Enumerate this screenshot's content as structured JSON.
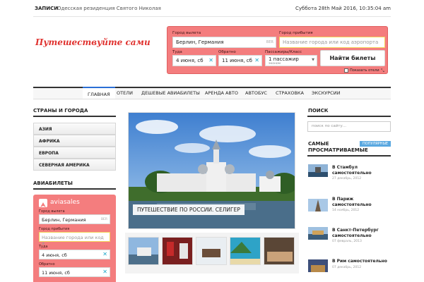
{
  "topbar": {
    "label": "ЗАПИСИ",
    "ticker": "Одесская резиденция Святого Николая",
    "datetime": "Суббота 28th Май 2016, 10:35:04 am"
  },
  "logo": {
    "text": "Путешествуйте сами"
  },
  "search_widget": {
    "from_label": "Город вылета",
    "from_value": "Берлин, Германия",
    "from_iata": "BER",
    "to_label": "Город прибытия",
    "to_placeholder": "Название города или код аэропорта",
    "depart_label": "Туда",
    "depart_value": "4 июня, сб",
    "return_label": "Обратно",
    "return_value": "11 июня, сб",
    "pax_label": "Пассажиры/Класс",
    "pax_value": "1 пассажир",
    "pax_class": "эконом",
    "find_button": "Найти билеты",
    "show_hotels": "Показать отели"
  },
  "nav": {
    "items": [
      "ГЛАВНАЯ",
      "ОТЕЛИ",
      "ДЕШЕВЫЕ АВИАБИЛЕТЫ",
      "АРЕНДА АВТО",
      "АВТОБУС",
      "СТРАХОВКА",
      "ЭКСКУРСИИ"
    ]
  },
  "left": {
    "countries_title": "СТРАНЫ И ГОРОДА",
    "categories": [
      "АЗИЯ",
      "АФРИКА",
      "ЕВРОПА",
      "СЕВЕРНАЯ АМЕРИКА"
    ],
    "avia_title": "АВИАБИЛЕТЫ",
    "avia": {
      "brand": "aviasales",
      "from_label": "Город вылета",
      "from_value": "Берлин, Германия",
      "from_iata": "BER",
      "to_label": "Город прибытия",
      "to_placeholder": "Название города или код а",
      "depart_label": "Туда",
      "depart_value": "4 июня, сб",
      "return_label": "Обратно",
      "return_value": "11 июня, сб"
    }
  },
  "hero": {
    "caption": "ПУТЕШЕСТВИЕ ПО РОССИИ. СЕЛИГЕР"
  },
  "right": {
    "search_title": "ПОИСК",
    "search_placeholder": "поиск по сайту...",
    "popular_title": "САМЫЕ ПРОСМАТРИВАЕМЫЕ",
    "popular_tab": "ПОПУЛЯРНЫЕ",
    "posts": [
      {
        "title": "В Стамбул самостоятельно",
        "date": "27 декабрь, 2012"
      },
      {
        "title": "В Париж самостоятельно",
        "date": "14 ноябрь, 2012"
      },
      {
        "title": "В Санкт-Петербург самостоятельно",
        "date": "07 февраль, 2013"
      },
      {
        "title": "В Рим самостоятельно",
        "date": "07 декабрь, 2012"
      }
    ]
  },
  "colors": {
    "widget_bg": "#f47d7e",
    "logo": "#e0322f",
    "nav_active": "#2b6fd5",
    "popular_tab": "#5aa8e0"
  }
}
